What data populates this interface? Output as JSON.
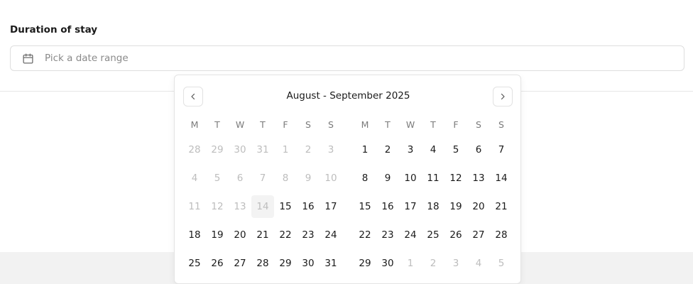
{
  "field": {
    "label": "Duration of stay",
    "placeholder": "Pick a date range",
    "icon": "calendar-icon"
  },
  "calendar": {
    "caption": "August - September 2025",
    "prev_icon": "chevron-left-icon",
    "next_icon": "chevron-right-icon",
    "weekdays": [
      "M",
      "T",
      "W",
      "T",
      "F",
      "S",
      "S"
    ],
    "months": [
      {
        "name": "August 2025",
        "weeks": [
          [
            {
              "d": "28",
              "muted": true
            },
            {
              "d": "29",
              "muted": true
            },
            {
              "d": "30",
              "muted": true
            },
            {
              "d": "31",
              "muted": true
            },
            {
              "d": "1",
              "muted": true
            },
            {
              "d": "2",
              "muted": true
            },
            {
              "d": "3",
              "muted": true
            }
          ],
          [
            {
              "d": "4",
              "muted": true
            },
            {
              "d": "5",
              "muted": true
            },
            {
              "d": "6",
              "muted": true
            },
            {
              "d": "7",
              "muted": true
            },
            {
              "d": "8",
              "muted": true
            },
            {
              "d": "9",
              "muted": true
            },
            {
              "d": "10",
              "muted": true
            }
          ],
          [
            {
              "d": "11",
              "muted": true
            },
            {
              "d": "12",
              "muted": true
            },
            {
              "d": "13",
              "muted": true
            },
            {
              "d": "14",
              "muted": true,
              "today": true
            },
            {
              "d": "15"
            },
            {
              "d": "16"
            },
            {
              "d": "17"
            }
          ],
          [
            {
              "d": "18"
            },
            {
              "d": "19"
            },
            {
              "d": "20"
            },
            {
              "d": "21"
            },
            {
              "d": "22"
            },
            {
              "d": "23"
            },
            {
              "d": "24"
            }
          ],
          [
            {
              "d": "25"
            },
            {
              "d": "26"
            },
            {
              "d": "27"
            },
            {
              "d": "28"
            },
            {
              "d": "29"
            },
            {
              "d": "30"
            },
            {
              "d": "31"
            }
          ]
        ]
      },
      {
        "name": "September 2025",
        "weeks": [
          [
            {
              "d": "1"
            },
            {
              "d": "2"
            },
            {
              "d": "3"
            },
            {
              "d": "4"
            },
            {
              "d": "5"
            },
            {
              "d": "6"
            },
            {
              "d": "7"
            }
          ],
          [
            {
              "d": "8"
            },
            {
              "d": "9"
            },
            {
              "d": "10"
            },
            {
              "d": "11"
            },
            {
              "d": "12"
            },
            {
              "d": "13"
            },
            {
              "d": "14"
            }
          ],
          [
            {
              "d": "15"
            },
            {
              "d": "16"
            },
            {
              "d": "17"
            },
            {
              "d": "18"
            },
            {
              "d": "19"
            },
            {
              "d": "20"
            },
            {
              "d": "21"
            }
          ],
          [
            {
              "d": "22"
            },
            {
              "d": "23"
            },
            {
              "d": "24"
            },
            {
              "d": "25"
            },
            {
              "d": "26"
            },
            {
              "d": "27"
            },
            {
              "d": "28"
            }
          ],
          [
            {
              "d": "29"
            },
            {
              "d": "30"
            },
            {
              "d": "1",
              "muted": true
            },
            {
              "d": "2",
              "muted": true
            },
            {
              "d": "3",
              "muted": true
            },
            {
              "d": "4",
              "muted": true
            },
            {
              "d": "5",
              "muted": true
            }
          ]
        ]
      }
    ]
  }
}
